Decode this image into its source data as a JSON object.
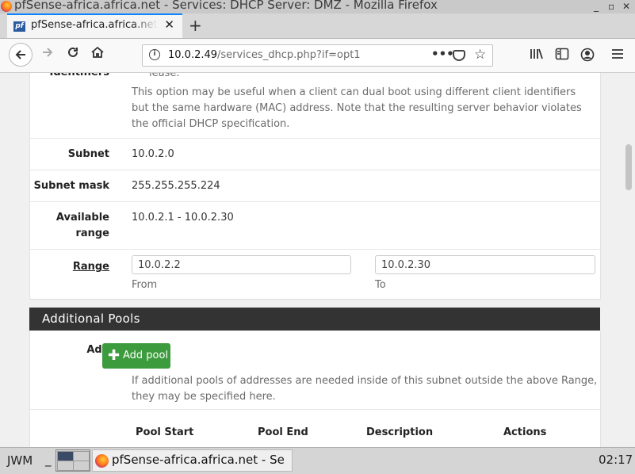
{
  "window": {
    "title": "pfSense-africa.africa.net - Services: DHCP Server: DMZ - Mozilla Firefox",
    "controls": {
      "minimize": "_",
      "maximize": "▫",
      "close": "✕"
    }
  },
  "tabs": [
    {
      "label": "pfSense-africa.africa.net - S",
      "favicon": "pf",
      "close": "✕"
    }
  ],
  "new_tab": "+",
  "url": {
    "host": "10.0.2.49",
    "path": "/services_dhcp.php?if=opt1",
    "page_actions": "•••"
  },
  "form": {
    "identifiers_label": "Identifiers",
    "identifiers_help_line0": "lease.",
    "identifiers_help": "This option may be useful when a client can dual boot using different client identifiers but the same hardware (MAC) address. Note that the resulting server behavior violates the official DHCP specification.",
    "subnet_label": "Subnet",
    "subnet": "10.0.2.0",
    "mask_label": "Subnet mask",
    "mask": "255.255.255.224",
    "avail_label": "Available range",
    "avail": "10.0.2.1 - 10.0.2.30",
    "range_label": "Range",
    "range_from": "10.0.2.2",
    "range_to": "10.0.2.30",
    "from_label": "From",
    "to_label": "To"
  },
  "pools": {
    "heading": "Additional Pools",
    "add_label": "Add",
    "add_button": "Add pool",
    "help": "If additional pools of addresses are needed inside of this subnet outside the above Range, they may be specified here.",
    "columns": [
      "Pool Start",
      "Pool End",
      "Description",
      "Actions"
    ]
  },
  "taskbar": {
    "menu": "JWM",
    "sep": "_",
    "window_title": "pfSense-africa.africa.net - Se",
    "clock": "02:17"
  },
  "colors": {
    "accent": "#0a84ff",
    "section_header": "#333333",
    "success": "#3c9b3c"
  }
}
